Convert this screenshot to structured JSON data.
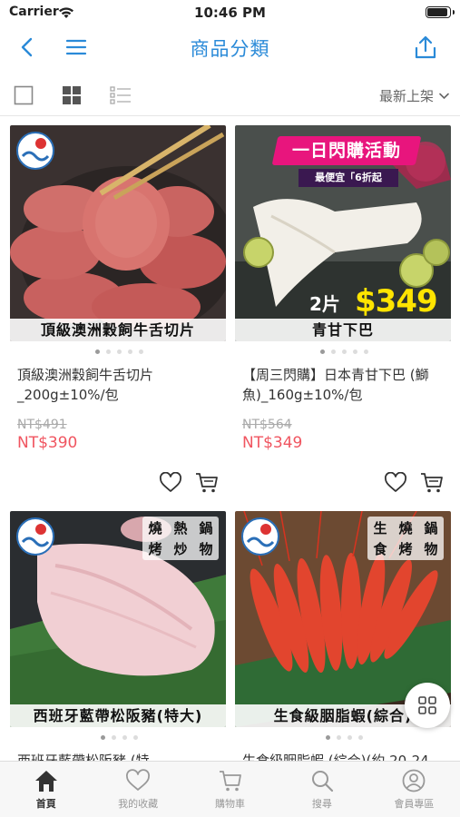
{
  "status_bar": {
    "carrier": "Carrier",
    "time": "10:46 PM"
  },
  "nav": {
    "title": "商品分類"
  },
  "toolbar": {
    "sort_label": "最新上架"
  },
  "products": [
    {
      "caption": "頂級澳洲穀飼牛舌切片",
      "name": "頂級澳洲穀飼牛舌切片_200g±10%/包",
      "old_price": "NT$491",
      "price": "NT$390"
    },
    {
      "caption": "青甘下巴",
      "name": "【周三閃購】日本青甘下巴 (鰤魚)_160g±10%/包",
      "old_price": "NT$564",
      "price": "NT$349",
      "promo_title": "一日閃購活動",
      "promo_sub": "最便宜「6折起",
      "promo_count": "2片",
      "promo_price": "$349"
    },
    {
      "caption": "西班牙藍帶松阪豬(特大)",
      "name": "西班牙藍帶松阪豬 (特",
      "tags": [
        "燒",
        "熱",
        "鍋",
        "烤",
        "炒",
        "物"
      ]
    },
    {
      "caption": "生食級胭脂蝦(綜合)",
      "name": "生食級胭脂蝦 (綜合)(約 20-24",
      "tags": [
        "生",
        "燒",
        "鍋",
        "食",
        "烤",
        "物"
      ]
    }
  ],
  "tabs": [
    {
      "label": "首頁",
      "icon": "home-icon"
    },
    {
      "label": "我的收藏",
      "icon": "heart-icon"
    },
    {
      "label": "購物車",
      "icon": "cart-icon"
    },
    {
      "label": "搜尋",
      "icon": "search-icon"
    },
    {
      "label": "會員專區",
      "icon": "user-icon"
    }
  ],
  "colors": {
    "accent": "#2a8ad8",
    "sale_price": "#f05560",
    "promo_yellow": "#ffe400",
    "promo_magenta": "#e8157d"
  }
}
